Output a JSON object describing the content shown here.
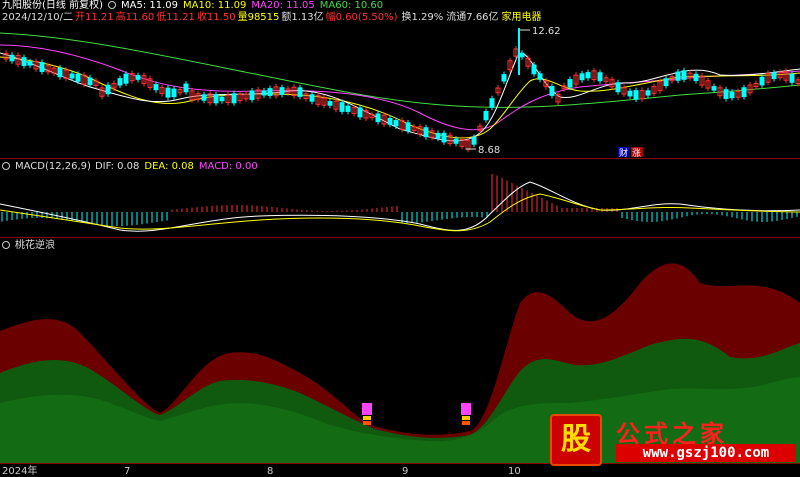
{
  "header": {
    "stock_name": "九阳股份(日线 前复权)",
    "ma_labels": [
      {
        "text": "MA5: 11.09",
        "color": "#ffffff"
      },
      {
        "text": "MA10: 11.09",
        "color": "#ffff00"
      },
      {
        "text": "MA20: 11.05",
        "color": "#ff44ff"
      },
      {
        "text": "MA60: 10.60",
        "color": "#44dd44"
      }
    ]
  },
  "quote": {
    "date": "2024/12/10/二",
    "open": "开11.21",
    "high": "高11.60",
    "low": "低11.21",
    "close": "收11.50",
    "volume": "量98515",
    "amount": "额1.13亿",
    "change": "幅0.60(5.50%)",
    "turnover": "换1.29%",
    "float_cap": "流通7.66亿",
    "industry": "家用电器"
  },
  "price_chart": {
    "high_marker": "12.62",
    "low_marker": "8.68",
    "badges": [
      "财",
      "涨"
    ]
  },
  "macd": {
    "name": "MACD(12,26,9)",
    "dif": "DIF: 0.08",
    "dea": "DEA: 0.08",
    "macd": "MACD: 0.00"
  },
  "indicator": {
    "name": "桃花逆浪"
  },
  "x_axis": [
    "2024年",
    "7",
    "8",
    "9",
    "10"
  ],
  "watermark": {
    "icon_char": "股",
    "title": "公式之家",
    "url": "www.gszj100.com"
  },
  "colors": {
    "up": "#ff3030",
    "down": "#00ffff",
    "ma5": "#ffffff",
    "ma10": "#ffff00",
    "ma20": "#ff44ff",
    "ma60": "#44dd44",
    "dark_red": "#6b0000",
    "dark_green": "#0f5a0f"
  }
}
